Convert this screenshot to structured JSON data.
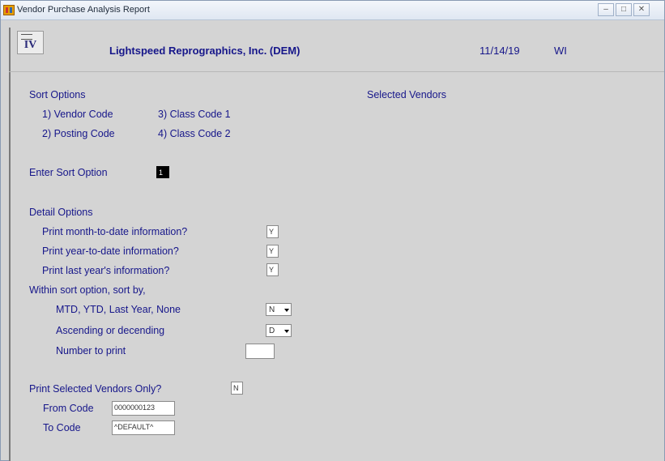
{
  "window": {
    "title": "Vendor Purchase Analysis Report",
    "controls": [
      "–",
      "□",
      "✕"
    ]
  },
  "header": {
    "logo": "IV",
    "company": "Lightspeed Reprographics, Inc. (DEM)",
    "date": "11/14/19",
    "user": "WI"
  },
  "sort_options": {
    "heading": "Sort Options",
    "options": [
      "1) Vendor Code",
      "3) Class Code 1",
      "2) Posting Code",
      "4) Class Code 2"
    ],
    "enter_label": "Enter Sort Option",
    "enter_value": "1"
  },
  "selected_vendors_heading": "Selected Vendors",
  "detail_options": {
    "heading": "Detail Options",
    "mtd_label": "Print month-to-date information?",
    "mtd_value": "Y",
    "ytd_label": "Print year-to-date information?",
    "ytd_value": "Y",
    "last_year_label": "Print last year's information?",
    "last_year_value": "Y",
    "within_label": "Within sort option, sort by,",
    "sort_by_label": "MTD, YTD, Last Year, None",
    "sort_by_value": "N",
    "order_label": "Ascending or decending",
    "order_value": "D",
    "number_label": "Number to print",
    "number_value": ""
  },
  "selected_only": {
    "label": "Print Selected Vendors Only?",
    "value": "N",
    "from_label": "From Code",
    "from_value": "0000000123",
    "to_label": "To Code",
    "to_value": "^DEFAULT^"
  }
}
